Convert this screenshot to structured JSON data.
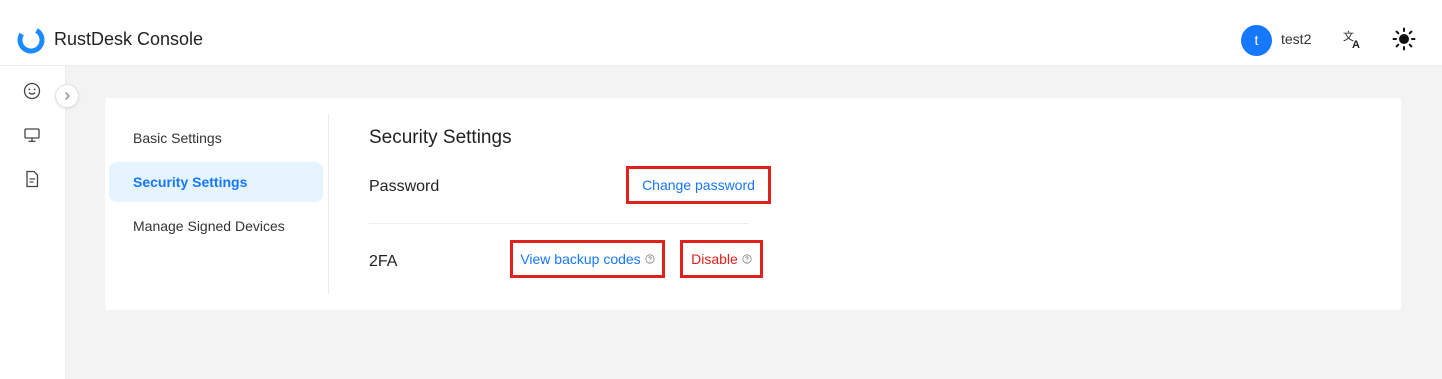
{
  "header": {
    "app_title": "RustDesk Console",
    "logo_icon": "rustdesk-logo-icon",
    "user": {
      "avatar_letter": "t",
      "name": "test2",
      "avatar_color": "#1677ff"
    },
    "language_icon": "translate-icon",
    "theme_icon": "sun-icon"
  },
  "rail": {
    "items": [
      {
        "icon": "smile-icon"
      },
      {
        "icon": "desktop-icon"
      },
      {
        "icon": "file-text-icon"
      }
    ],
    "collapse_icon": "chevron-right-icon"
  },
  "settings_menu": {
    "items": [
      {
        "label": "Basic Settings",
        "active": false
      },
      {
        "label": "Security Settings",
        "active": true
      },
      {
        "label": "Manage Signed Devices",
        "active": false
      }
    ]
  },
  "security": {
    "title": "Security Settings",
    "password": {
      "label": "Password",
      "action": "Change password"
    },
    "twofa": {
      "label": "2FA",
      "view_codes": "View backup codes",
      "disable": "Disable"
    }
  },
  "colors": {
    "accent": "#1677ff",
    "danger": "#e0211d",
    "highlight_border": "#e0211d"
  }
}
